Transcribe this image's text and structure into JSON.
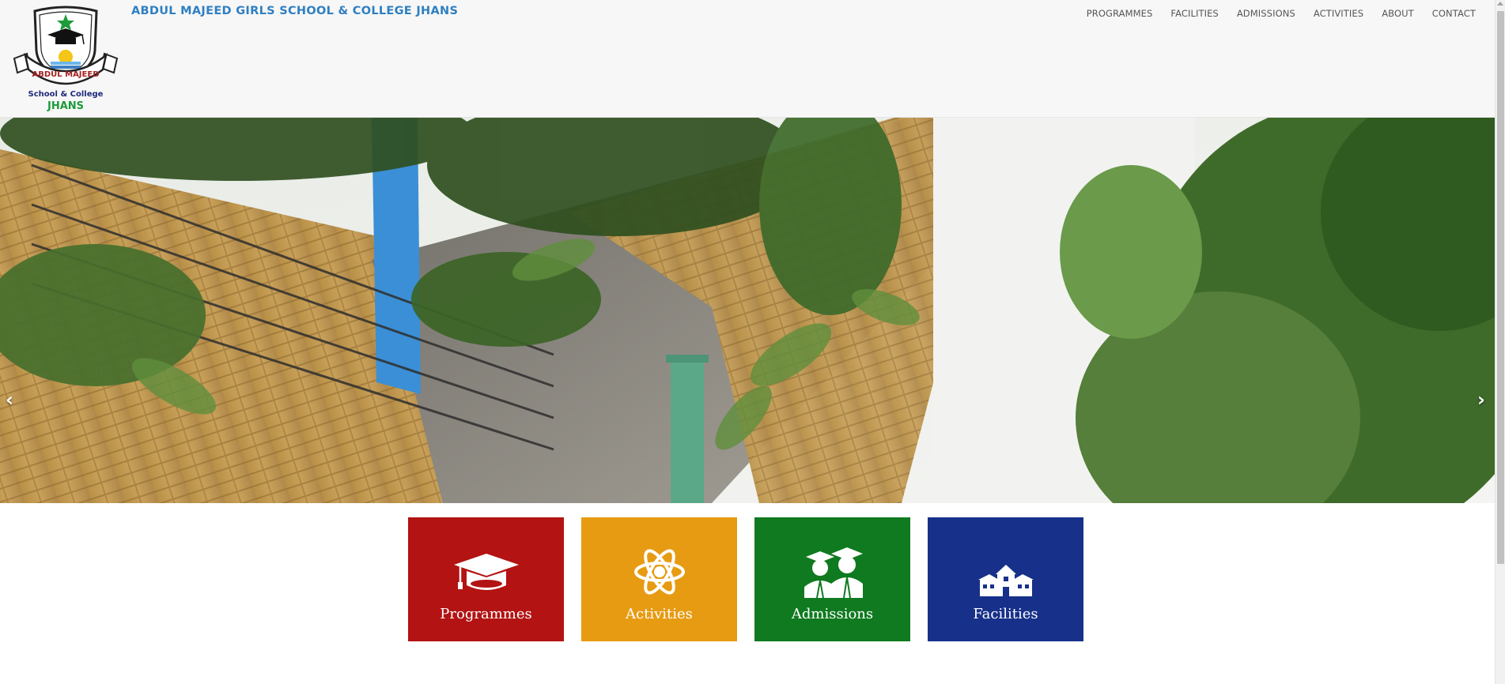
{
  "header": {
    "site_title": "ABDUL MAJEED GIRLS SCHOOL & COLLEGE JHANS",
    "logo": {
      "arc_text": "ABDUL MAJEED",
      "line1": "School & College",
      "line2": "JHANS"
    }
  },
  "nav": {
    "items": [
      {
        "label": "PROGRAMMES"
      },
      {
        "label": "FACILITIES"
      },
      {
        "label": "ADMISSIONS"
      },
      {
        "label": "ACTIVITIES"
      },
      {
        "label": "ABOUT"
      },
      {
        "label": "CONTACT"
      }
    ]
  },
  "slider": {
    "prev": "‹",
    "next": "›"
  },
  "tiles": [
    {
      "label": "Programmes",
      "icon": "graduation-cap-icon",
      "color": "#b31313"
    },
    {
      "label": "Activities",
      "icon": "atom-icon",
      "color": "#e79b12"
    },
    {
      "label": "Admissions",
      "icon": "students-icon",
      "color": "#0f7a1f"
    },
    {
      "label": "Facilities",
      "icon": "school-building-icon",
      "color": "#17308a"
    }
  ]
}
